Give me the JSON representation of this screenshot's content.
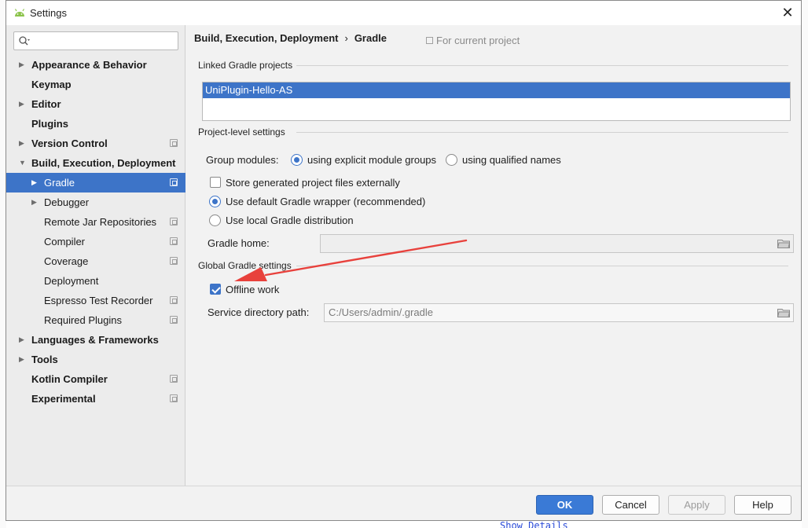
{
  "window": {
    "title": "Settings"
  },
  "search": {
    "placeholder": ""
  },
  "sidebar": {
    "items": [
      {
        "label": "Appearance & Behavior",
        "bold": true,
        "expandable": true
      },
      {
        "label": "Keymap",
        "bold": true
      },
      {
        "label": "Editor",
        "bold": true,
        "expandable": true
      },
      {
        "label": "Plugins",
        "bold": true
      },
      {
        "label": "Version Control",
        "bold": true,
        "expandable": true,
        "project_badge": true
      },
      {
        "label": "Build, Execution, Deployment",
        "bold": true,
        "expanded": true
      },
      {
        "label": "Gradle",
        "selected": true,
        "expandable": true,
        "project_badge": true
      },
      {
        "label": "Debugger",
        "expandable": true
      },
      {
        "label": "Remote Jar Repositories",
        "project_badge": true
      },
      {
        "label": "Compiler",
        "project_badge": true
      },
      {
        "label": "Coverage",
        "project_badge": true
      },
      {
        "label": "Deployment"
      },
      {
        "label": "Espresso Test Recorder",
        "project_badge": true
      },
      {
        "label": "Required Plugins",
        "project_badge": true
      },
      {
        "label": "Languages & Frameworks",
        "bold": true,
        "expandable": true
      },
      {
        "label": "Tools",
        "bold": true,
        "expandable": true
      },
      {
        "label": "Kotlin Compiler",
        "bold": true,
        "project_badge": true
      },
      {
        "label": "Experimental",
        "bold": true,
        "project_badge": true
      }
    ]
  },
  "breadcrumb": {
    "parent": "Build, Execution, Deployment",
    "separator": "›",
    "current": "Gradle"
  },
  "scope_note": "For current project",
  "linked_projects": {
    "title": "Linked Gradle projects",
    "items": [
      "UniPlugin-Hello-AS"
    ]
  },
  "project_level": {
    "title": "Project-level settings",
    "group_modules_label": "Group modules:",
    "option_explicit": "using explicit module groups",
    "option_qualified": "using qualified names",
    "store_externally": "Store generated project files externally",
    "default_wrapper": "Use default Gradle wrapper (recommended)",
    "local_distribution": "Use local Gradle distribution",
    "gradle_home_label": "Gradle home:",
    "gradle_home_value": ""
  },
  "global": {
    "title": "Global Gradle settings",
    "offline_work": "Offline work",
    "service_dir_label": "Service directory path:",
    "service_dir_value": "C:/Users/admin/.gradle"
  },
  "buttons": {
    "ok": "OK",
    "cancel": "Cancel",
    "apply": "Apply",
    "help": "Help"
  },
  "background": {
    "link_text": "Show Details"
  },
  "colors": {
    "accent": "#3d74c8",
    "annotation_arrow": "#e8413c"
  }
}
